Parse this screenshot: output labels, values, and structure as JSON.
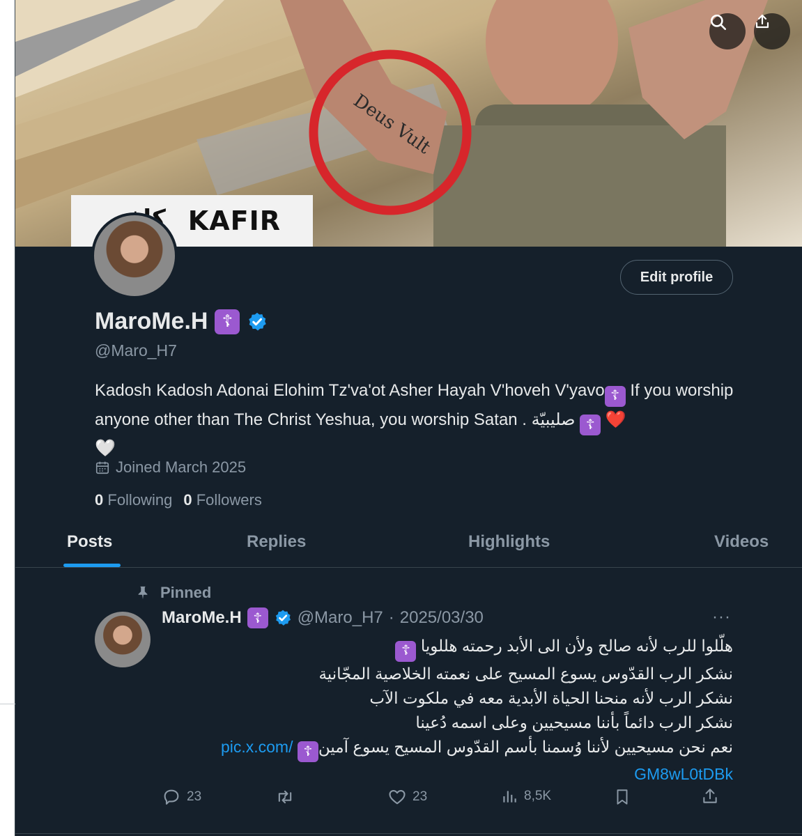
{
  "banner": {
    "caption_text": "KAFIR",
    "caption_arabic": "كافر",
    "tattoo_text": "Deus Vult"
  },
  "top_actions": {
    "search_icon": "search-icon",
    "share_icon": "share-icon"
  },
  "profile": {
    "display_name": "MaroMe.H",
    "emoji": "☦",
    "handle": "@Maro_H7",
    "edit_button": "Edit profile",
    "bio_text_1": "Kadosh Kadosh Adonai Elohim Tz'va'ot Asher Hayah V'hoveh V'yavo",
    "bio_text_2": " If you worship anyone other than The Christ Yeshua, you worship Satan . صليبيّة ",
    "heart_red": "❤️",
    "heart_white": "🤍",
    "joined": "Joined March 2025",
    "following_count": "0",
    "following_label": "Following",
    "followers_count": "0",
    "followers_label": "Followers"
  },
  "tabs": [
    {
      "label": "Posts",
      "active": true
    },
    {
      "label": "Replies",
      "active": false
    },
    {
      "label": "Highlights",
      "active": false
    },
    {
      "label": "Videos",
      "active": false
    }
  ],
  "post": {
    "pinned_label": "Pinned",
    "author_name": "MaroMe.H",
    "author_handle": "@Maro_H7",
    "separator": "·",
    "date": "2025/03/30",
    "more": "···",
    "lines": [
      "هلّلوا للرب لأنه صالح ولأن الى الأبد رحمته هللويا",
      "نشكر الرب القدّوس يسوع المسيح على نعمته الخلاصية المجّانية",
      "نشكر الرب لأنه منحنا الحياة الأبدية معه في ملكوت الآب",
      "نشكر الرب دائماً بأننا مسيحيين وعلى اسمه دُعينا",
      "نعم نحن مسيحيين لأننا وُسمنا بأسم القدّوس المسيح يسوع آمين"
    ],
    "link_part1": "pic.x.com/",
    "link_part2": "GM8wL0tDBk",
    "replies": "23",
    "likes": "23",
    "views": "8,5K"
  }
}
